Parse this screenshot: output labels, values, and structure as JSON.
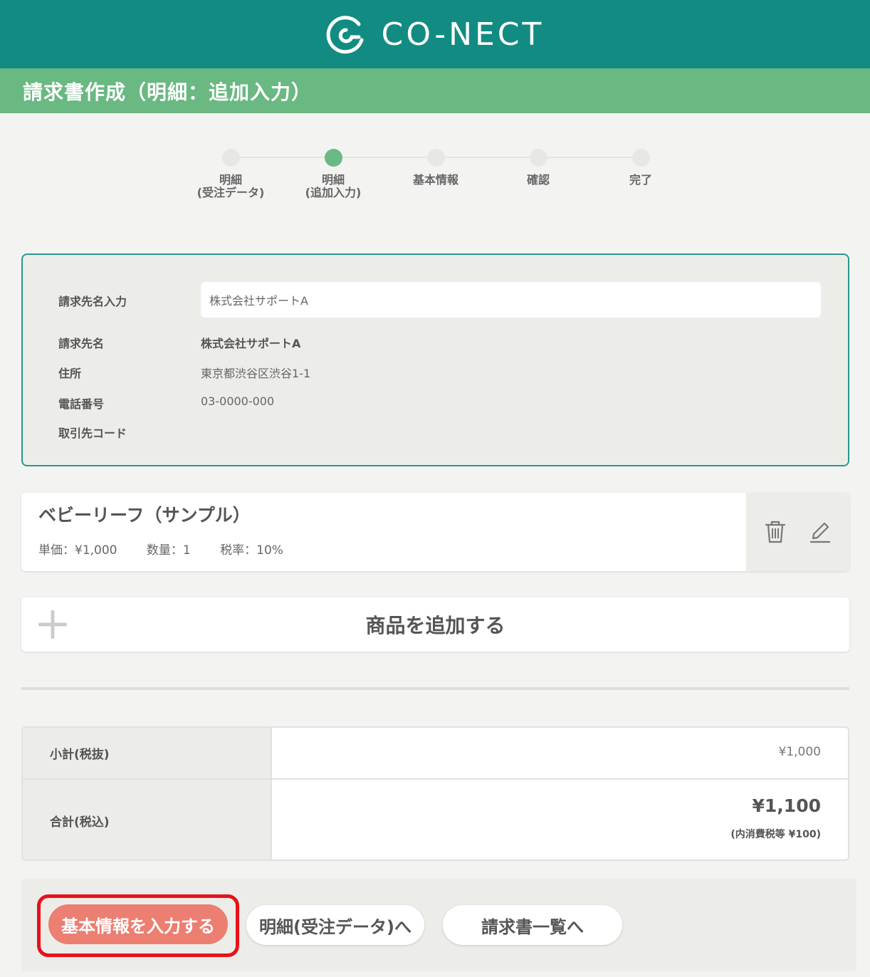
{
  "app": {
    "brand": "CO-NECT"
  },
  "page": {
    "title": "請求書作成（明細：追加入力）"
  },
  "steps": [
    {
      "label": "明細\n(受注データ)",
      "active": false
    },
    {
      "label": "明細\n(追加入力)",
      "active": true
    },
    {
      "label": "基本情報",
      "active": false
    },
    {
      "label": "確認",
      "active": false
    },
    {
      "label": "完了",
      "active": false
    }
  ],
  "billing": {
    "input_label": "請求先名入力",
    "input_value": "株式会社サポートA",
    "name_label": "請求先名",
    "name_value": "株式会社サポートA",
    "address_label": "住所",
    "address_value": "東京都渋谷区渋谷1-1",
    "phone_label": "電話番号",
    "phone_value": "03-0000-000",
    "code_label": "取引先コード",
    "code_value": ""
  },
  "item": {
    "name": "ベビーリーフ（サンプル）",
    "unit_price": "単価：¥1,000",
    "quantity": "数量：1",
    "tax_rate": "税率：10%",
    "delete_icon": "trash-icon",
    "edit_icon": "pencil-icon"
  },
  "add_item": {
    "label": "商品を追加する",
    "icon": "plus-icon"
  },
  "totals": {
    "subtotal_label": "小計(税抜)",
    "subtotal_value": "¥1,000",
    "total_label": "合計(税込)",
    "total_value": "¥1,100",
    "tax_note": "(内消費税等 ¥100)"
  },
  "footer": {
    "primary_label": "基本情報を入力する",
    "back_label": "明細(受注データ)へ",
    "list_label": "請求書一覧へ"
  },
  "colors": {
    "header": "#128c82",
    "title_bar": "#6ab882",
    "primary_button": "#ec7e72",
    "highlight": "#e8121a"
  }
}
